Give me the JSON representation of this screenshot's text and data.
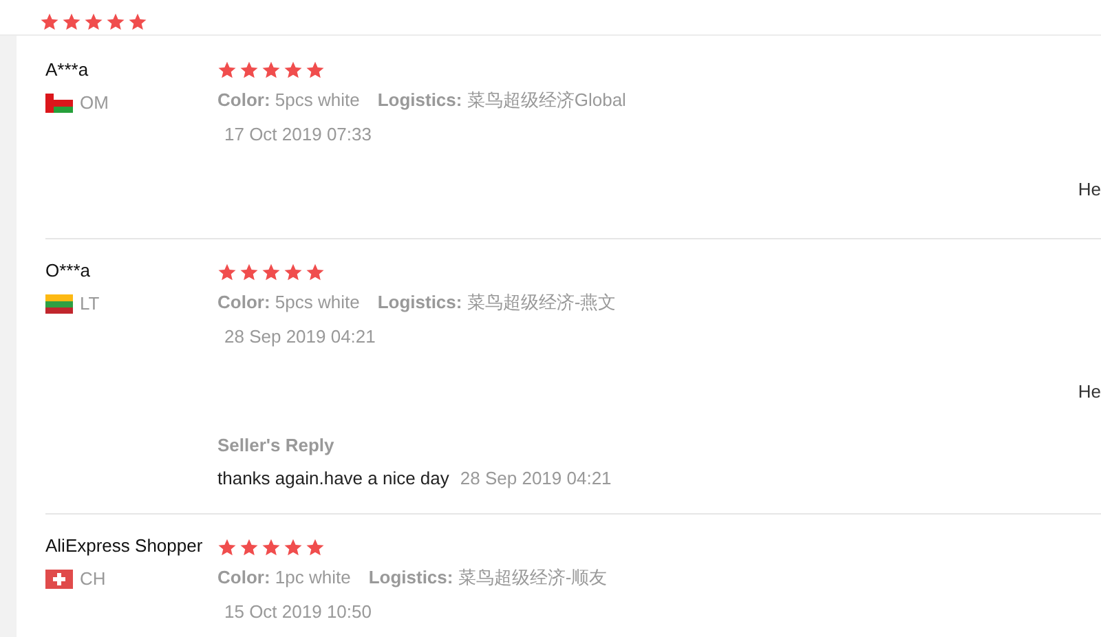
{
  "top_rating": {
    "stars": 5
  },
  "reviews": [
    {
      "name": "A***a",
      "flag": {
        "kind": "oman"
      },
      "country": "OM",
      "stars": 5,
      "color_label": "Color:",
      "color_value": "5pcs white",
      "logistics_label": "Logistics:",
      "logistics_value": "菜鸟超级经济Global",
      "date": "17 Oct 2019 07:33",
      "helpful": "He"
    },
    {
      "name": "O***a",
      "flag": {
        "kind": "lithuania"
      },
      "country": "LT",
      "stars": 5,
      "color_label": "Color:",
      "color_value": "5pcs white",
      "logistics_label": "Logistics:",
      "logistics_value": "菜鸟超级经济-燕文",
      "date": "28 Sep 2019 04:21",
      "helpful": "He",
      "seller_reply": {
        "title": "Seller's Reply",
        "text": "thanks again.have a nice day",
        "date": "28 Sep 2019 04:21"
      }
    },
    {
      "name": "AliExpress Shopper",
      "flag": {
        "kind": "switzerland"
      },
      "country": "CH",
      "stars": 5,
      "color_label": "Color:",
      "color_value": "1pc white",
      "logistics_label": "Logistics:",
      "logistics_value": "菜鸟超级经济-顺友",
      "date": "15 Oct 2019 10:50"
    }
  ]
}
